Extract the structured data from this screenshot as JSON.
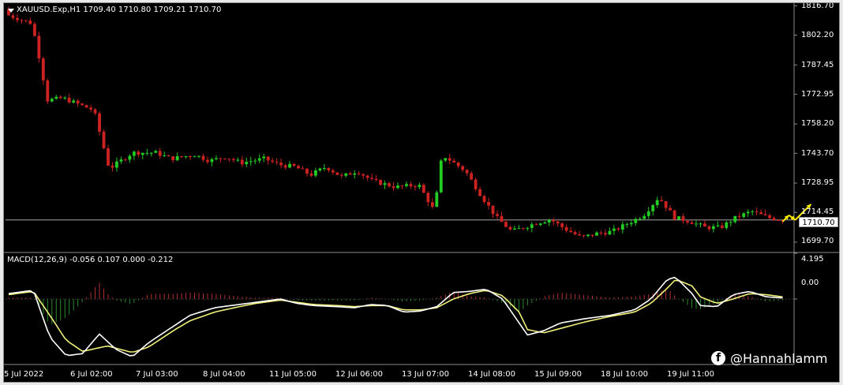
{
  "header": {
    "price_title": "XAUUSD.Exp,H1  1709.40 1710.80 1709.21 1710.70",
    "macd_title": "MACD(12,26,9) -0.056 0.107 0.000 -0.212"
  },
  "price_axis": [
    "1816.70",
    "1802.20",
    "1787.45",
    "1772.95",
    "1758.20",
    "1743.70",
    "1728.95",
    "1714.45",
    "1699.70"
  ],
  "current_price": "1710.70",
  "macd_axis": [
    "4.195",
    "0.00"
  ],
  "time_axis": [
    "5 Jul 2022",
    "6 Jul 02:00",
    "7 Jul 03:00",
    "8 Jul 04:00",
    "11 Jul 05:00",
    "12 Jul 06:00",
    "13 Jul 07:00",
    "14 Jul 08:00",
    "15 Jul 09:00",
    "18 Jul 10:00",
    "19 Jul 11:00"
  ],
  "watermark": {
    "icon": "facebook-icon",
    "handle": "@Hannahlamm"
  },
  "colors": {
    "bull_candle": "#22cc22",
    "bear_candle": "#cc2222",
    "macd_line": "#ffffff",
    "signal_line": "#f0f07a",
    "hist_positive": "#b03030",
    "hist_negative": "#2a8a2a",
    "annotation_arrow": "#ffee00",
    "current_price_line": "#bbbbbb"
  },
  "chart_data": [
    {
      "type": "candlestick",
      "symbol": "XAUUSD.Exp",
      "timeframe": "H1",
      "ohlc_last": {
        "open": 1709.4,
        "high": 1710.8,
        "low": 1709.21,
        "close": 1710.7
      },
      "ylim": [
        1695.0,
        1818.0
      ],
      "close_path": [
        [
          0,
          1812
        ],
        [
          3,
          1808
        ],
        [
          4,
          1790
        ],
        [
          5,
          1770
        ],
        [
          7,
          1771
        ],
        [
          9,
          1768
        ],
        [
          11,
          1765
        ],
        [
          13,
          1736
        ],
        [
          16,
          1744
        ],
        [
          19,
          1744
        ],
        [
          21,
          1741
        ],
        [
          24,
          1743
        ],
        [
          26,
          1740
        ],
        [
          28,
          1742
        ],
        [
          30,
          1739
        ],
        [
          33,
          1741
        ],
        [
          35,
          1738
        ],
        [
          37,
          1737
        ],
        [
          39,
          1733
        ],
        [
          41,
          1737
        ],
        [
          43,
          1732
        ],
        [
          45,
          1735
        ],
        [
          47,
          1730
        ],
        [
          50,
          1727
        ],
        [
          53,
          1728
        ],
        [
          55,
          1715
        ],
        [
          56,
          1743
        ],
        [
          59,
          1735
        ],
        [
          61,
          1723
        ],
        [
          63,
          1712
        ],
        [
          65,
          1705
        ],
        [
          68,
          1709
        ],
        [
          70,
          1711
        ],
        [
          72,
          1706
        ],
        [
          74,
          1702
        ],
        [
          76,
          1704
        ],
        [
          78,
          1705
        ],
        [
          80,
          1709
        ],
        [
          82,
          1713
        ],
        [
          84,
          1722
        ],
        [
          86,
          1712
        ],
        [
          88,
          1710
        ],
        [
          90,
          1707
        ],
        [
          92,
          1707
        ],
        [
          94,
          1712
        ],
        [
          96,
          1715
        ],
        [
          98,
          1712
        ],
        [
          100,
          1710.7
        ]
      ],
      "last_close": 1710.7
    },
    {
      "type": "macd",
      "params": [
        12,
        26,
        9
      ],
      "values": {
        "main": -0.056,
        "signal": 0.107,
        "level": 0.0,
        "histogram": -0.212
      },
      "ylim": [
        -6.0,
        4.195
      ],
      "macd_path": [
        [
          0,
          0.5
        ],
        [
          3,
          0.8
        ],
        [
          5,
          -3.5
        ],
        [
          7,
          -5.2
        ],
        [
          9,
          -5.0
        ],
        [
          11,
          -3.2
        ],
        [
          13,
          -4.6
        ],
        [
          15,
          -5.3
        ],
        [
          17,
          -4.0
        ],
        [
          20,
          -2.5
        ],
        [
          22,
          -1.5
        ],
        [
          25,
          -0.8
        ],
        [
          28,
          -0.5
        ],
        [
          30,
          -0.3
        ],
        [
          33,
          0.0
        ],
        [
          35,
          -0.4
        ],
        [
          37,
          -0.6
        ],
        [
          40,
          -0.7
        ],
        [
          42,
          -0.8
        ],
        [
          44,
          -0.5
        ],
        [
          46,
          -0.6
        ],
        [
          48,
          -1.2
        ],
        [
          50,
          -1.1
        ],
        [
          52,
          -0.7
        ],
        [
          54,
          0.6
        ],
        [
          56,
          0.7
        ],
        [
          58,
          0.9
        ],
        [
          60,
          0.0
        ],
        [
          62,
          -2.2
        ],
        [
          63,
          -3.3
        ],
        [
          65,
          -2.9
        ],
        [
          67,
          -2.2
        ],
        [
          70,
          -1.8
        ],
        [
          73,
          -1.5
        ],
        [
          76,
          -1.0
        ],
        [
          78,
          0.0
        ],
        [
          80,
          1.8
        ],
        [
          81,
          2.0
        ],
        [
          83,
          0.5
        ],
        [
          84,
          -0.6
        ],
        [
          86,
          -0.7
        ],
        [
          88,
          0.4
        ],
        [
          90,
          0.7
        ],
        [
          92,
          0.2
        ],
        [
          94,
          0.1
        ]
      ],
      "signal_path": [
        [
          0,
          0.4
        ],
        [
          3,
          0.7
        ],
        [
          5,
          -1.5
        ],
        [
          7,
          -3.8
        ],
        [
          9,
          -4.8
        ],
        [
          12,
          -4.3
        ],
        [
          15,
          -4.9
        ],
        [
          17,
          -4.4
        ],
        [
          20,
          -2.9
        ],
        [
          22,
          -2.0
        ],
        [
          25,
          -1.2
        ],
        [
          28,
          -0.7
        ],
        [
          30,
          -0.4
        ],
        [
          33,
          -0.1
        ],
        [
          35,
          -0.3
        ],
        [
          37,
          -0.5
        ],
        [
          40,
          -0.6
        ],
        [
          42,
          -0.7
        ],
        [
          44,
          -0.6
        ],
        [
          46,
          -0.6
        ],
        [
          48,
          -1.0
        ],
        [
          50,
          -1.0
        ],
        [
          52,
          -0.8
        ],
        [
          54,
          0.0
        ],
        [
          56,
          0.5
        ],
        [
          58,
          0.8
        ],
        [
          60,
          0.3
        ],
        [
          62,
          -1.2
        ],
        [
          63,
          -2.8
        ],
        [
          65,
          -3.1
        ],
        [
          67,
          -2.7
        ],
        [
          70,
          -2.1
        ],
        [
          73,
          -1.6
        ],
        [
          76,
          -1.2
        ],
        [
          78,
          -0.4
        ],
        [
          80,
          1.0
        ],
        [
          81,
          1.8
        ],
        [
          83,
          1.2
        ],
        [
          84,
          0.2
        ],
        [
          86,
          -0.4
        ],
        [
          88,
          0.0
        ],
        [
          90,
          0.5
        ],
        [
          92,
          0.4
        ],
        [
          94,
          0.2
        ]
      ]
    }
  ]
}
